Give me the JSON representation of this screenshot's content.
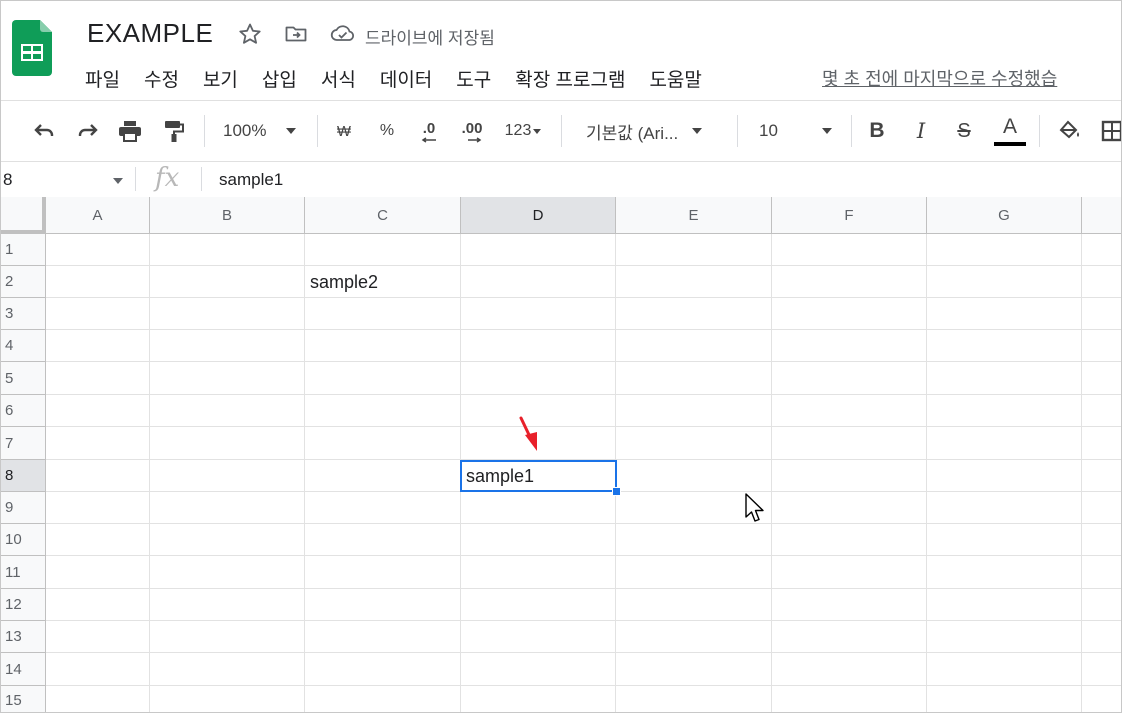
{
  "header": {
    "doc_title": "EXAMPLE",
    "saved_status": "드라이브에 저장됨",
    "last_edit": "몇 초 전에 마지막으로 수정했습",
    "menu": [
      "파일",
      "수정",
      "보기",
      "삽입",
      "서식",
      "데이터",
      "도구",
      "확장 프로그램",
      "도움말"
    ]
  },
  "toolbar": {
    "zoom": "100%",
    "currency": "₩",
    "percent": "%",
    "decrease_decimal": ".0",
    "increase_decimal": ".00",
    "number_format": "123",
    "font": "기본값 (Ari...",
    "font_size": "10",
    "bold": "B",
    "italic": "I",
    "strike": "S",
    "text_color": "A"
  },
  "formula_bar": {
    "name_box": "8",
    "fx": "fx",
    "value": "sample1"
  },
  "grid": {
    "columns": [
      "A",
      "B",
      "C",
      "D",
      "E",
      "F",
      "G"
    ],
    "rows": [
      "1",
      "2",
      "3",
      "4",
      "5",
      "6",
      "7",
      "8",
      "9",
      "10",
      "11",
      "12",
      "13",
      "14",
      "15"
    ],
    "selected_column": "D",
    "selected_row": "8",
    "cells": {
      "C2": "sample2",
      "D8": "sample1"
    }
  },
  "colors": {
    "accent": "#1a73e8",
    "sheets_green": "#0f9d58",
    "arrow": "#e8202a"
  }
}
